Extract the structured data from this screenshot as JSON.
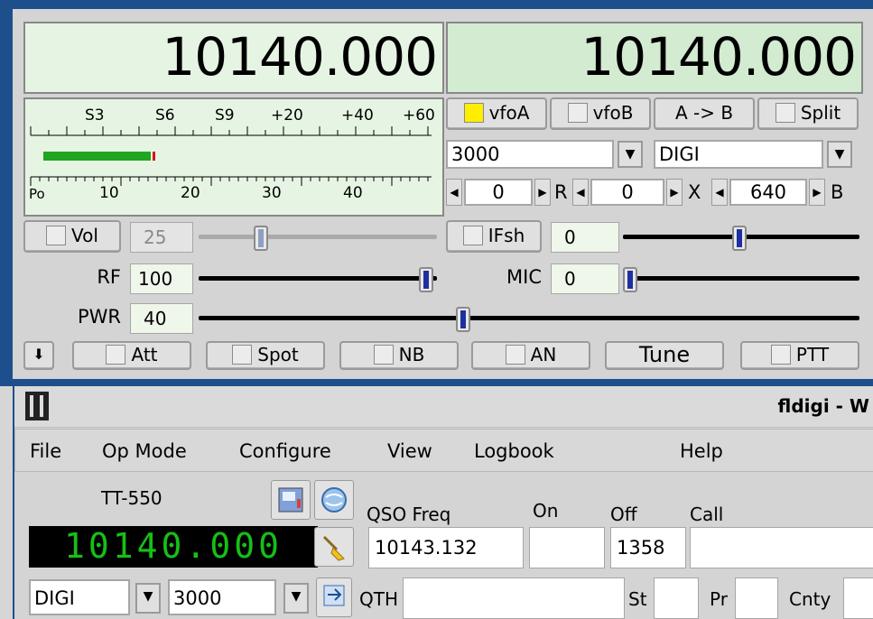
{
  "rig": {
    "freq_a": "10140.000",
    "freq_b": "10140.000",
    "meter": {
      "s_scale": [
        "S3",
        "S6",
        "S9",
        "+20",
        "+40",
        "+60"
      ],
      "po_scale": [
        "Po",
        "10",
        "20",
        "30",
        "40"
      ],
      "s_level_fraction": 0.27
    },
    "buttons": {
      "vfoA": "vfoA",
      "vfoB": "vfoB",
      "a_to_b": "A -> B",
      "split": "Split"
    },
    "bandwidth": "3000",
    "mode": "DIGI",
    "shift_r": "0",
    "shift_x": "0",
    "shift_b": "640",
    "r_label": "R",
    "x_label": "X",
    "b_label": "B",
    "vol": {
      "label": "Vol",
      "value": "25",
      "level": 0.25
    },
    "ifsh": {
      "label": "IFsh",
      "value": "0",
      "level": 0.5
    },
    "rf": {
      "label": "RF",
      "value": "100",
      "level": 1.0
    },
    "mic": {
      "label": "MIC",
      "value": "0",
      "level": 0.0
    },
    "pwr": {
      "label": "PWR",
      "value": "40",
      "level": 0.4
    },
    "bottom": {
      "att": "Att",
      "spot": "Spot",
      "nb": "NB",
      "an": "AN",
      "tune": "Tune",
      "ptt": "PTT"
    }
  },
  "fldigi": {
    "title": "fldigi - W",
    "menu": [
      "File",
      "Op Mode",
      "Configure",
      "View",
      "Logbook",
      "Help"
    ],
    "rig_name": "TT-550",
    "lcd_freq": "10140.000",
    "headers": {
      "qso_freq": "QSO Freq",
      "on": "On",
      "off": "Off",
      "call": "Call"
    },
    "qso_freq_value": "10143.132",
    "off_value": "1358",
    "mode": "DIGI",
    "bandwidth": "3000",
    "row2": {
      "qth": "QTH",
      "st": "St",
      "pr": "Pr",
      "cnty": "Cnty"
    }
  }
}
